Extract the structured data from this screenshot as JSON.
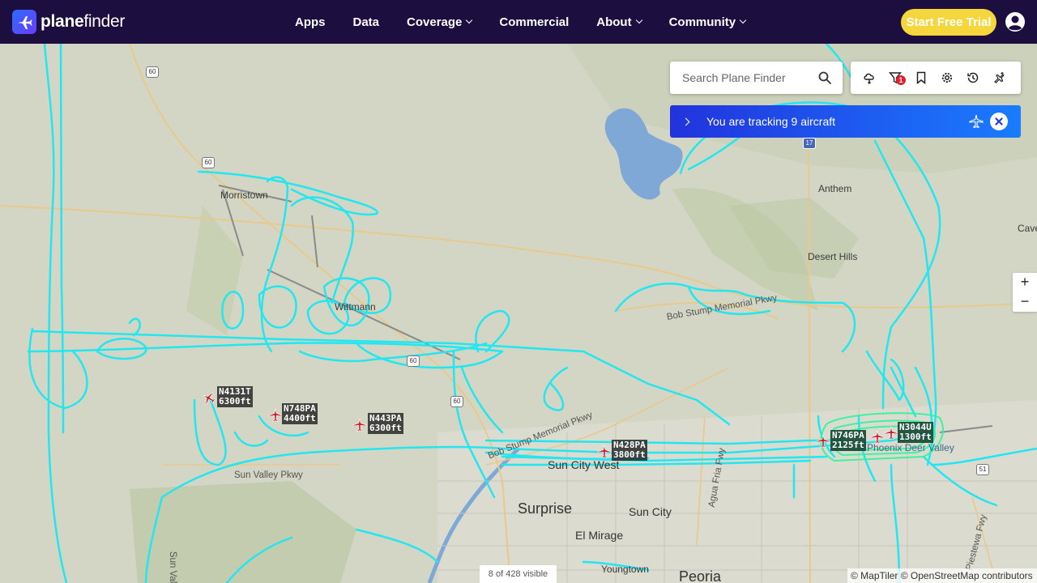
{
  "brand": {
    "name_part1": "plane",
    "name_part2": "finder"
  },
  "nav": {
    "items": [
      {
        "label": "Apps",
        "dropdown": false
      },
      {
        "label": "Data",
        "dropdown": false
      },
      {
        "label": "Coverage",
        "dropdown": true
      },
      {
        "label": "Commercial",
        "dropdown": false
      },
      {
        "label": "About",
        "dropdown": true
      },
      {
        "label": "Community",
        "dropdown": true
      }
    ],
    "cta_label": "Start Free Trial"
  },
  "search": {
    "placeholder": "Search Plane Finder"
  },
  "toolbar": {
    "tools": [
      "weather-icon",
      "filter-icon",
      "bookmark-icon",
      "settings-icon",
      "history-icon",
      "airport-icon"
    ],
    "filter_badge": "1"
  },
  "tracking": {
    "text": "You are tracking 9 aircraft"
  },
  "zoom": {
    "in_label": "+",
    "out_label": "−"
  },
  "places": {
    "morristown": "Morristown",
    "wittmann": "Wittmann",
    "anthem": "Anthem",
    "desert_hills": "Desert Hills",
    "cave": "Cave",
    "sun_city_west": "Sun City West",
    "surprise": "Surprise",
    "sun_city": "Sun City",
    "el_mirage": "El Mirage",
    "youngtown": "Youngtown",
    "peoria": "Peoria",
    "phoenix_dv": "Phoenix Deer Valley"
  },
  "roads": {
    "bob_stump": "Bob Stump Memorial Pkwy",
    "bob_stump_2": "Bob Stump Memorial Pkwy",
    "sun_valley": "Sun Valley Pkwy",
    "agua_fria": "Agua Fria Fwy",
    "piestewa": "Piestewa Fwy",
    "sun_valley_vertical": "Sun Valley"
  },
  "shields": {
    "us60_a": "60",
    "us60_b": "60",
    "i17": "17",
    "us60_c": "60",
    "us60_d": "60",
    "sr51": "51"
  },
  "aircraft": [
    {
      "callsign": "N4131T",
      "altitude": "6300ft"
    },
    {
      "callsign": "N748PA",
      "altitude": "4400ft"
    },
    {
      "callsign": "N443PA",
      "altitude": "6300ft"
    },
    {
      "callsign": "N428PA",
      "altitude": "3800ft"
    },
    {
      "callsign": "N746PA",
      "altitude": "2125ft"
    },
    {
      "callsign": "N3044U",
      "altitude": "1300ft"
    }
  ],
  "colors": {
    "track": "#22e6f0",
    "track_green": "#2ef59a",
    "plane": "#c8202c",
    "header_bg": "#1c0e3f",
    "cta": "#f5d63c"
  },
  "footer": {
    "visible_count": "8 of 428 visible",
    "attribution": "© MapTiler © OpenStreetMap contributors"
  }
}
